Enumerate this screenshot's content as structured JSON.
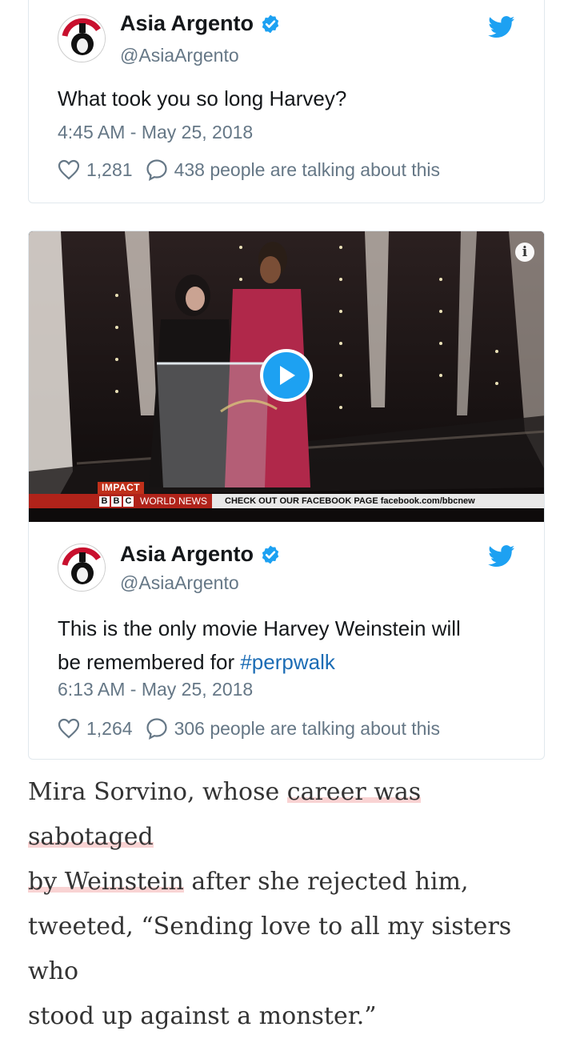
{
  "tweets": [
    {
      "display_name": "Asia Argento",
      "handle": "@AsiaArgento",
      "text": "What took you so long Harvey?",
      "timestamp": "4:45 AM - May 25, 2018",
      "likes": "1,281",
      "talking": "438 people are talking about this"
    },
    {
      "display_name": "Asia Argento",
      "handle": "@AsiaArgento",
      "text_line1": "This is the only movie Harvey Weinstein will",
      "text_line2_prefix": "be remembered for ",
      "hashtag": "#perpwalk",
      "timestamp": "6:13 AM - May 25, 2018",
      "likes": "1,264",
      "talking": "306 people are talking about this",
      "video": {
        "impact_label": "IMPACT",
        "bbc_letters": [
          "B",
          "B",
          "C"
        ],
        "world_news": "WORLD NEWS",
        "ticker_message": "CHECK OUT OUR FACEBOOK PAGE facebook.com/bbcnew"
      }
    }
  ],
  "article": {
    "lead": "Mira Sorvino, whose ",
    "link_part1": "career was sabotaged",
    "link_part2": "by Weinstein",
    "after_link": " after she rejected him,",
    "line3": "tweeted, “Sending love to all my sisters who",
    "line4": "stood up against a monster.”"
  },
  "colors": {
    "twitter_blue": "#1da1f2",
    "hashtag_blue": "#1b6cb5",
    "muted_gray": "#657786",
    "link_highlight": "#f9d3d3"
  },
  "icons": [
    "verified-badge-icon",
    "twitter-bird-icon",
    "heart-icon",
    "reply-bubble-icon",
    "play-icon",
    "info-icon"
  ]
}
